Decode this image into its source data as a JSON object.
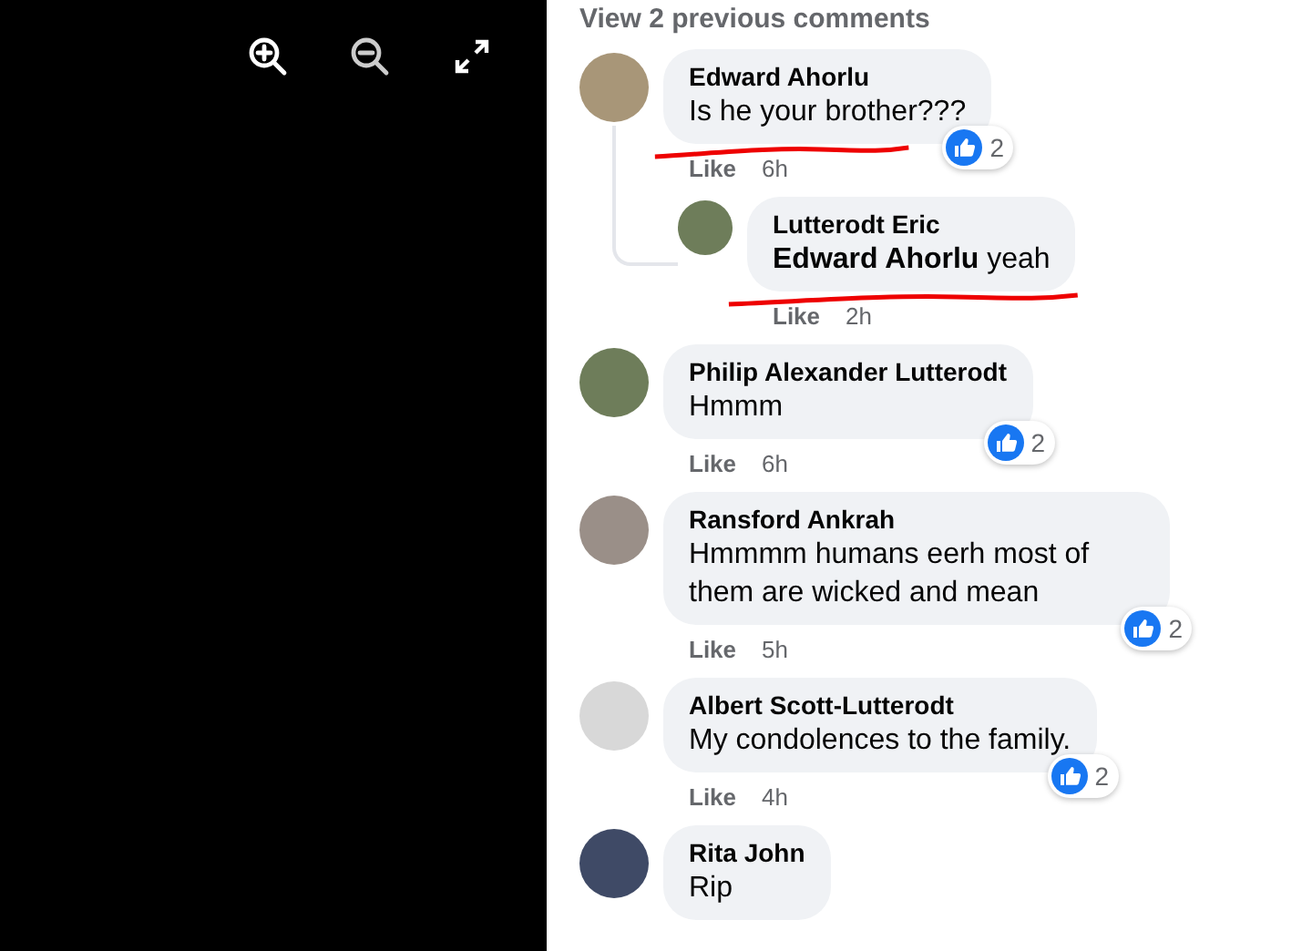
{
  "viewer_toolbar": [
    {
      "kind": "zoom-in"
    },
    {
      "kind": "zoom-out"
    },
    {
      "kind": "fullscreen"
    }
  ],
  "view_previous": "View 2 previous comments",
  "comments": [
    {
      "author": "Edward Ahorlu",
      "text": "Is he your brother???",
      "like": "Like",
      "time": "6h",
      "reactions": "2",
      "underlined": true,
      "replies": [
        {
          "author": "Lutterodt Eric",
          "text": "**Edward Ahorlu** yeah",
          "like": "Like",
          "time": "2h",
          "underlined": true
        }
      ]
    },
    {
      "author": "Philip Alexander Lutterodt",
      "text": "Hmmm",
      "like": "Like",
      "time": "6h",
      "reactions": "2",
      "underlined": false
    },
    {
      "author": "Ransford Ankrah",
      "text": "Hmmmm humans eerh most of them are wicked and mean",
      "like": "Like",
      "time": "5h",
      "reactions": "2",
      "underlined": false
    },
    {
      "author": "Albert Scott-Lutterodt",
      "text": "My condolences to the family.",
      "like": "Like",
      "time": "4h",
      "reactions": "2",
      "underlined": false
    },
    {
      "author": "Rita John",
      "text": "Rip",
      "underlined": false
    }
  ]
}
